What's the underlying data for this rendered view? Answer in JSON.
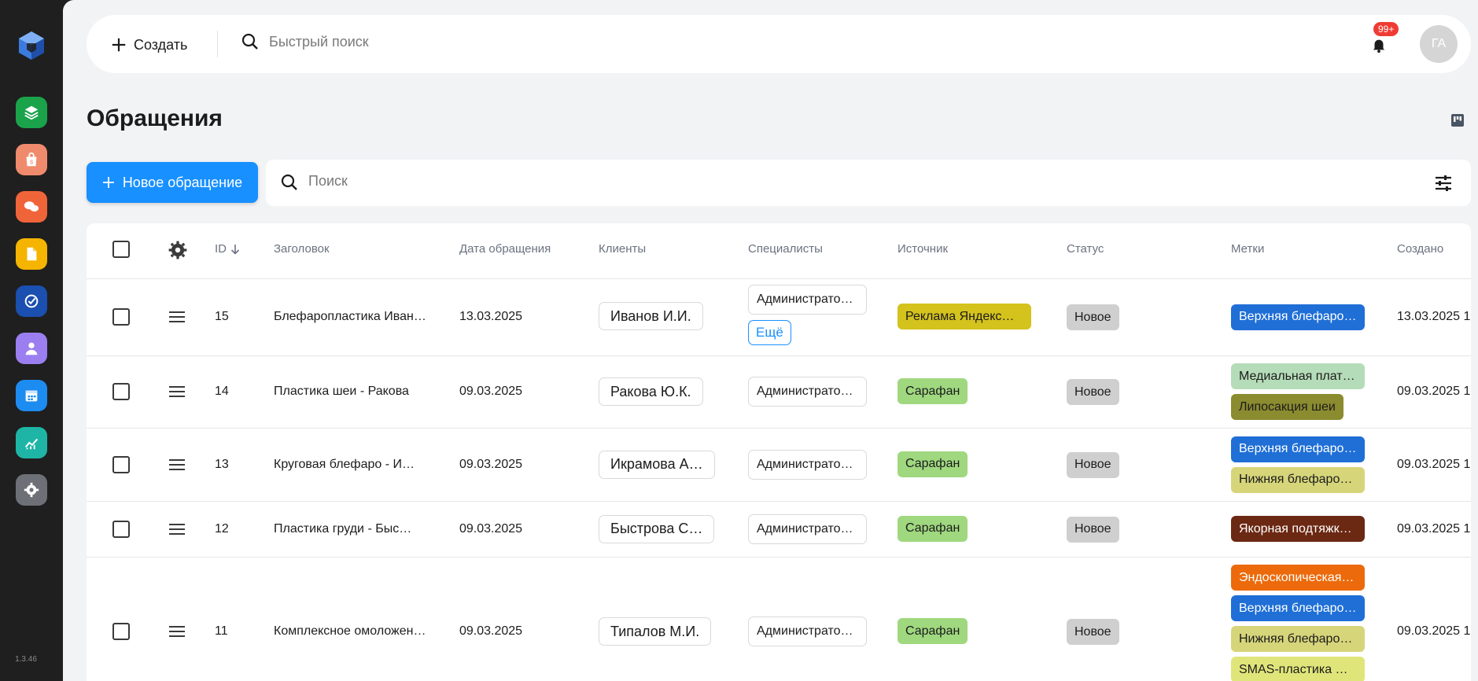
{
  "app": {
    "version": "1.3.46",
    "colors": {
      "accent": "#1890ff",
      "rail_bg": "#1f1f1f",
      "page_bg": "#f2f3f5",
      "badge": "#ef3b33"
    }
  },
  "sidebar": {
    "logo": "cube-logo-icon",
    "items": [
      {
        "icon": "layers-icon",
        "color": "#1aa34a"
      },
      {
        "icon": "shopping-bag-icon",
        "color": "#f08a6c"
      },
      {
        "icon": "chat-icon",
        "color": "#f0643a"
      },
      {
        "icon": "document-icon",
        "color": "#f5b400"
      },
      {
        "icon": "check-circle-icon",
        "color": "#1b4fb0"
      },
      {
        "icon": "user-icon",
        "color": "#9b7ff0"
      },
      {
        "icon": "calendar-icon",
        "color": "#1d8cf0"
      },
      {
        "icon": "chart-icon",
        "color": "#1fb5a6"
      },
      {
        "icon": "gear-icon",
        "color": "#6d7177"
      }
    ]
  },
  "topbar": {
    "create_label": "Создать",
    "search_placeholder": "Быстрый поиск",
    "notifications_count": "99+",
    "avatar_initials": "ГА"
  },
  "page": {
    "title": "Обращения",
    "new_button_label": "Новое обращение",
    "search_placeholder": "Поиск"
  },
  "table": {
    "columns": {
      "id": "ID",
      "title": "Заголовок",
      "date": "Дата обращения",
      "clients": "Клиенты",
      "specialists": "Специалисты",
      "source": "Источник",
      "status": "Статус",
      "tags": "Метки",
      "created": "Создано"
    },
    "more_label": "Ещё",
    "rows": [
      {
        "id": "15",
        "title": "Блефаропластика Иван…",
        "date": "13.03.2025",
        "client": "Иванов И.И.",
        "specialist": "Администрато…",
        "source": "Реклама Яндекс…",
        "source_color": "#d4c21d",
        "status": "Новое",
        "tags": [
          {
            "label": "Верхняя блефаро…",
            "bg": "#1f6fd6",
            "fg": "#ffffff"
          }
        ],
        "created": "13.03.2025 1"
      },
      {
        "id": "14",
        "title": "Пластика шеи - Ракова",
        "date": "09.03.2025",
        "client": "Ракова Ю.К.",
        "specialist": "Администрато…",
        "source": "Сарафан",
        "source_color": "#9fd87f",
        "status": "Новое",
        "tags": [
          {
            "label": "Медиальная плат…",
            "bg": "#b5dcb8",
            "fg": "#1c1c1c"
          },
          {
            "label": "Липосакция шеи",
            "bg": "#8b8b2f",
            "fg": "#1c1c1c"
          }
        ],
        "created": "09.03.2025 1"
      },
      {
        "id": "13",
        "title": "Круговая блефаро - И…",
        "date": "09.03.2025",
        "client": "Икрамова А…",
        "specialist": "Администрато…",
        "source": "Сарафан",
        "source_color": "#9fd87f",
        "status": "Новое",
        "tags": [
          {
            "label": "Верхняя блефаро…",
            "bg": "#1f6fd6",
            "fg": "#ffffff"
          },
          {
            "label": "Нижняя блефаро…",
            "bg": "#d6d57a",
            "fg": "#1c1c1c"
          }
        ],
        "created": "09.03.2025 1"
      },
      {
        "id": "12",
        "title": "Пластика груди - Быс…",
        "date": "09.03.2025",
        "client": "Быстрова С…",
        "specialist": "Администрато…",
        "source": "Сарафан",
        "source_color": "#9fd87f",
        "status": "Новое",
        "tags": [
          {
            "label": "Якорная подтяжк…",
            "bg": "#6b2813",
            "fg": "#ffffff"
          }
        ],
        "created": "09.03.2025 1"
      },
      {
        "id": "11",
        "title": "Комплексное омоложен…",
        "date": "09.03.2025",
        "client": "Типалов М.И.",
        "specialist": "Администрато…",
        "source": "Сарафан",
        "source_color": "#9fd87f",
        "status": "Новое",
        "tags": [
          {
            "label": "Эндоскопическая…",
            "bg": "#ec6a0b",
            "fg": "#ffffff"
          },
          {
            "label": "Верхняя блефаро…",
            "bg": "#1f6fd6",
            "fg": "#ffffff"
          },
          {
            "label": "Нижняя блефаро…",
            "bg": "#d6d57a",
            "fg": "#1c1c1c"
          },
          {
            "label": "SMAS-пластика …",
            "bg": "#e0e57a",
            "fg": "#1c1c1c"
          }
        ],
        "created": "09.03.2025 1"
      }
    ]
  }
}
